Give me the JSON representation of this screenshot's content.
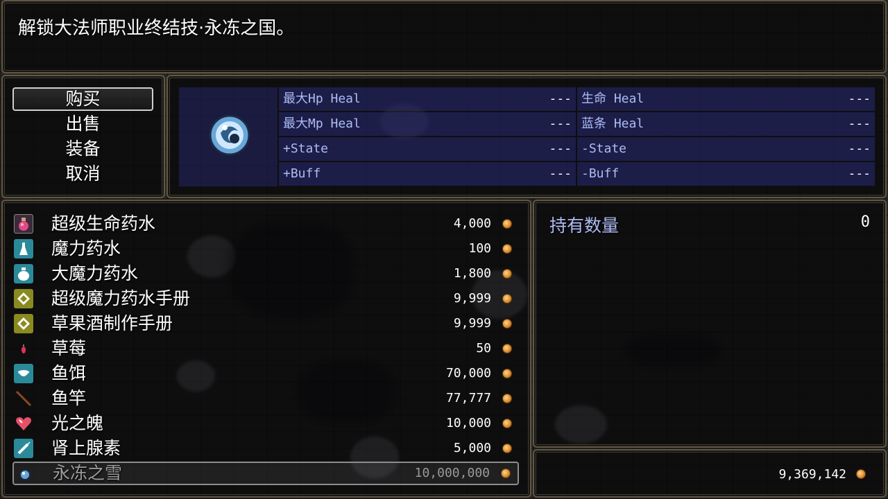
{
  "help": {
    "text": "解锁大法师职业终结技·永冻之国。"
  },
  "commands": [
    {
      "label": "购买",
      "selected": true
    },
    {
      "label": "出售",
      "selected": false
    },
    {
      "label": "装备",
      "selected": false
    },
    {
      "label": "取消",
      "selected": false
    }
  ],
  "status": {
    "icon": "ice-orb-icon",
    "rows": [
      {
        "left_label": "最大Hp Heal",
        "left_value": "---",
        "right_label": "生命 Heal",
        "right_value": "---"
      },
      {
        "left_label": "最大Mp Heal",
        "left_value": "---",
        "right_label": "蓝条 Heal",
        "right_value": "---"
      },
      {
        "left_label": "+State",
        "left_value": "---",
        "right_label": "-State",
        "right_value": "---"
      },
      {
        "left_label": "+Buff",
        "left_value": "---",
        "right_label": "-Buff",
        "right_value": "---"
      }
    ]
  },
  "items": [
    {
      "name": "超级生命药水",
      "price": "4,000",
      "icon": "potion-icon"
    },
    {
      "name": "魔力药水",
      "price": "100",
      "icon": "flask-icon"
    },
    {
      "name": "大魔力药水",
      "price": "1,800",
      "icon": "large-flask-icon"
    },
    {
      "name": "超级魔力药水手册",
      "price": "9,999",
      "icon": "book-icon"
    },
    {
      "name": "草果酒制作手册",
      "price": "9,999",
      "icon": "book-icon"
    },
    {
      "name": "草莓",
      "price": "50",
      "icon": "strawberry-icon"
    },
    {
      "name": "鱼饵",
      "price": "70,000",
      "icon": "bait-icon"
    },
    {
      "name": "鱼竿",
      "price": "77,777",
      "icon": "fishing-rod-icon"
    },
    {
      "name": "光之魄",
      "price": "10,000",
      "icon": "heart-icon"
    },
    {
      "name": "肾上腺素",
      "price": "5,000",
      "icon": "syringe-icon"
    },
    {
      "name": "永冻之雪",
      "price": "10,000,000",
      "icon": "snow-orb-icon",
      "selected": true,
      "disabled": true
    }
  ],
  "possession": {
    "label": "持有数量",
    "value": "0"
  },
  "gold": {
    "value": "9,369,142",
    "icon": "coin-icon"
  },
  "colors": {
    "system_blue": "#aebcf5",
    "selected_border": "#cfcfcf",
    "window_border": "#5f5846"
  }
}
